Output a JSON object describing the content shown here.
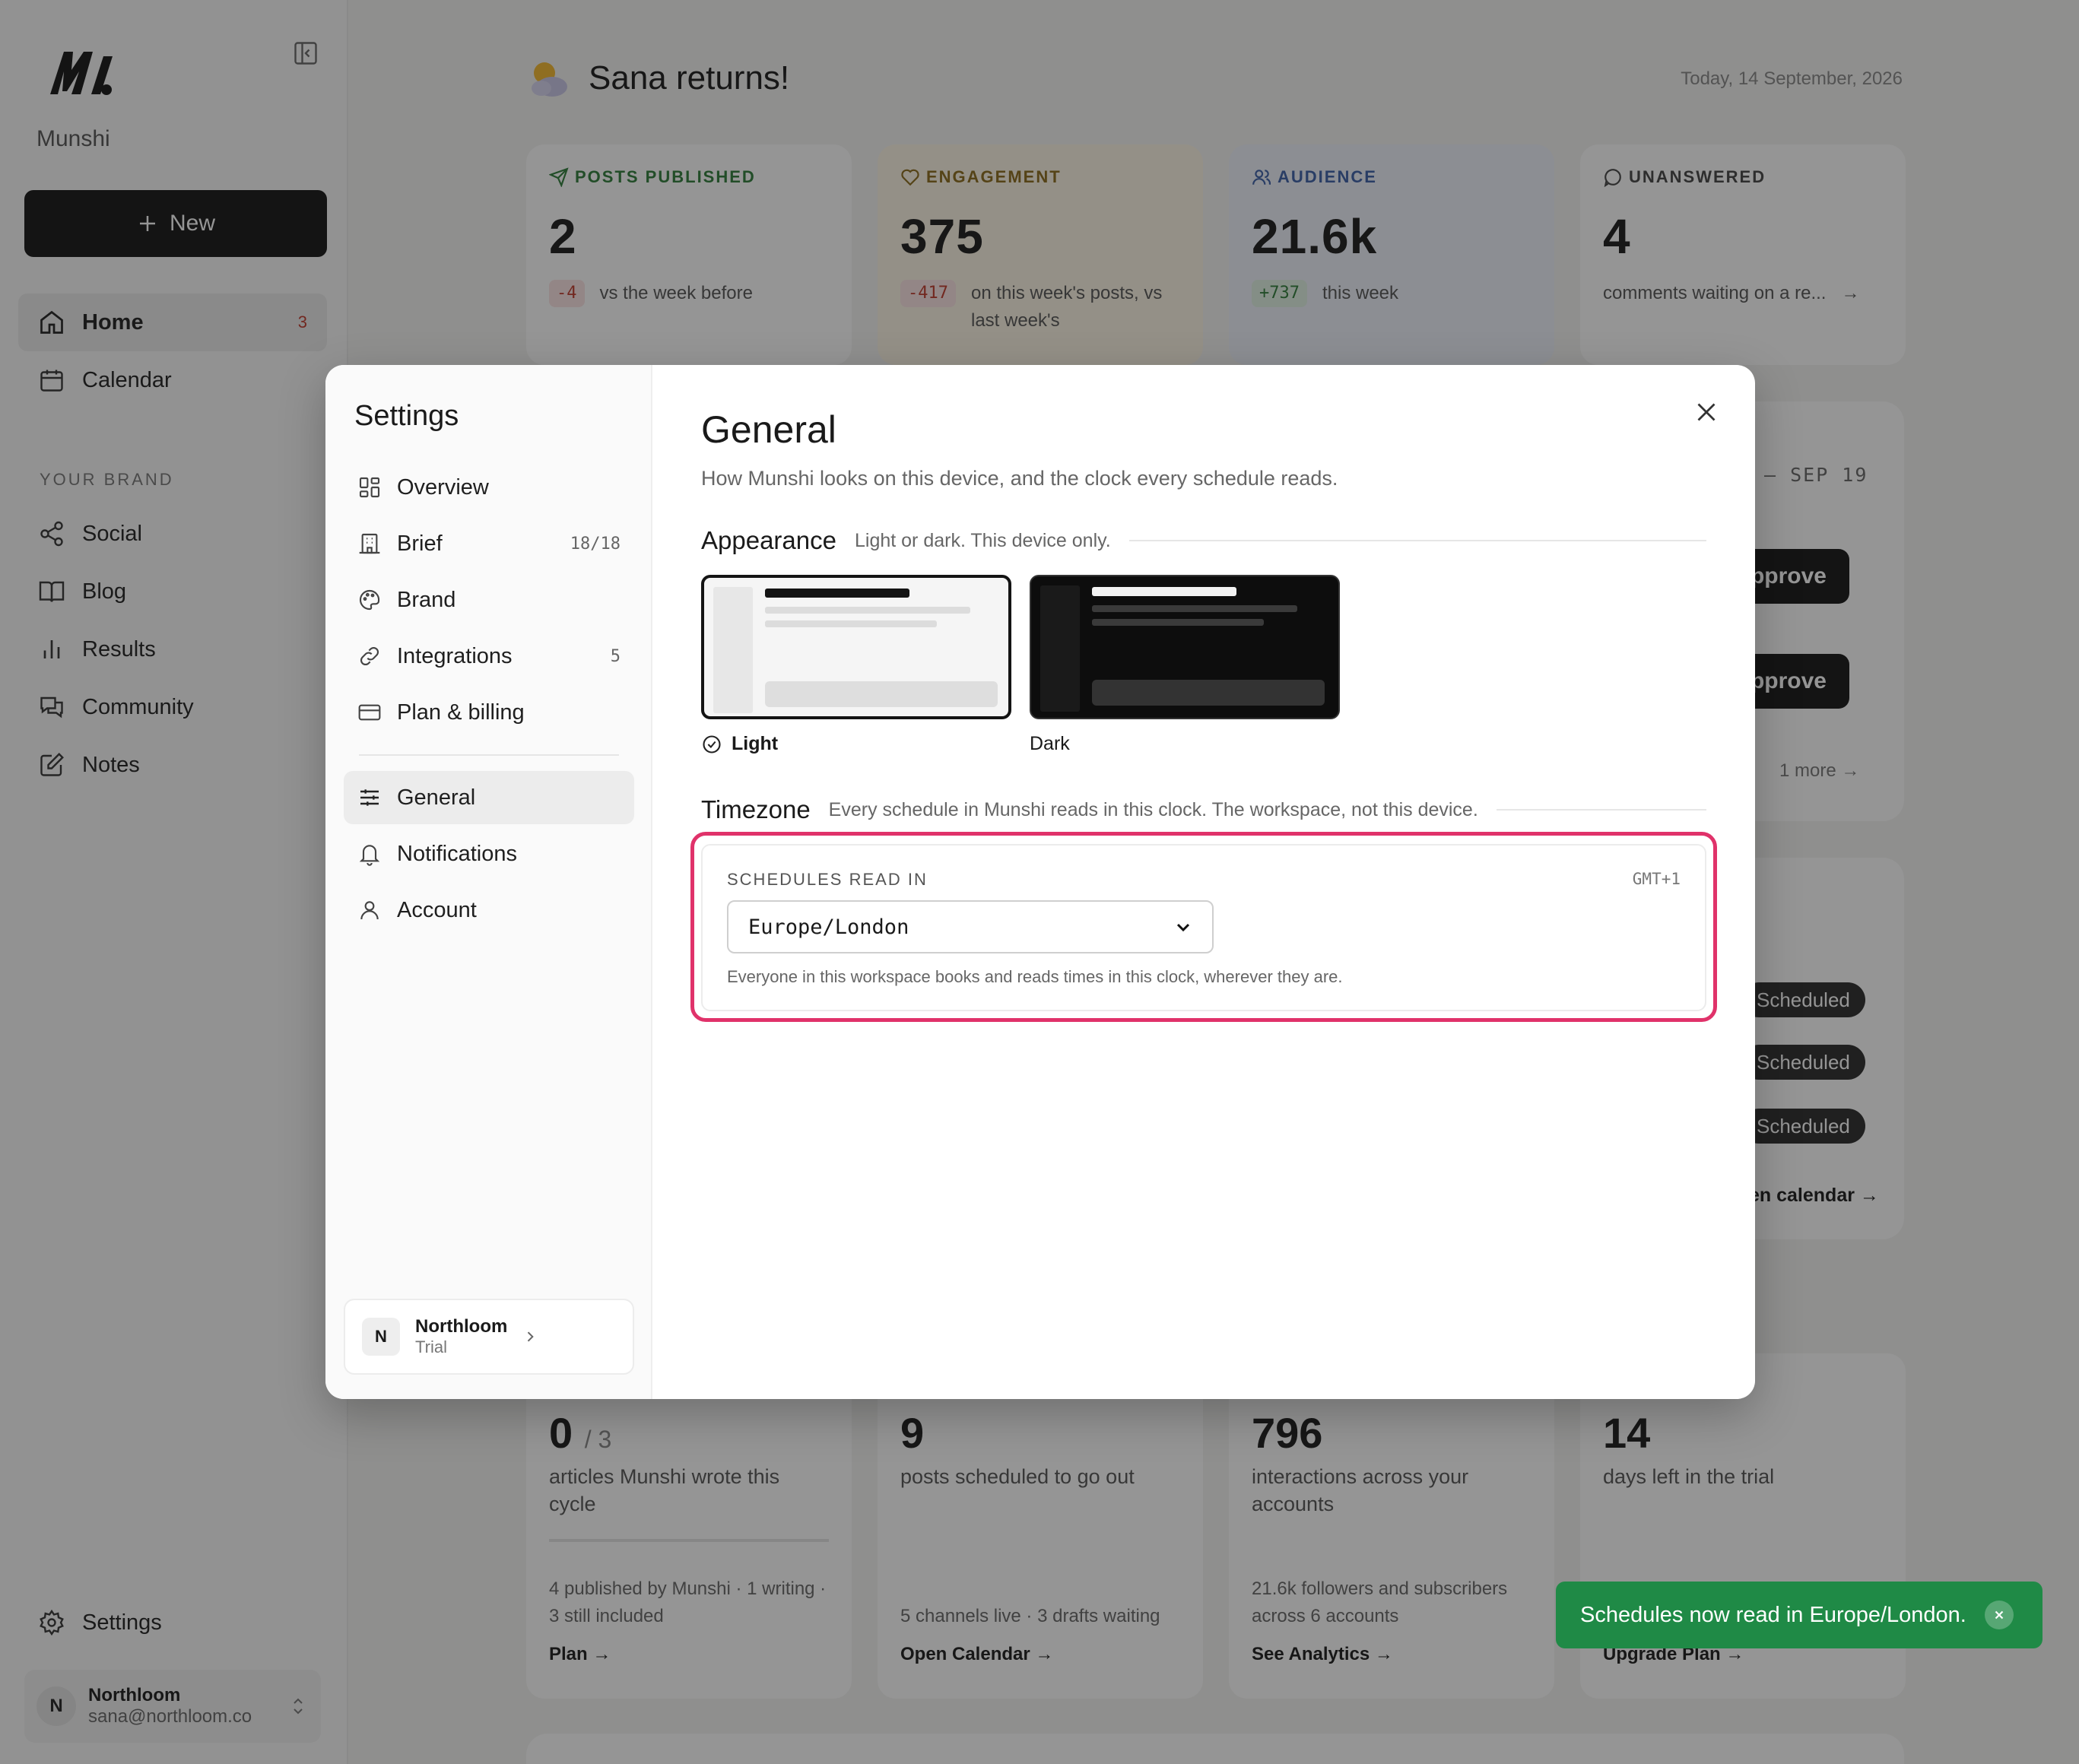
{
  "app": {
    "brand_name": "Munshi",
    "new_button_label": "New",
    "nav": [
      {
        "label": "Home",
        "badge": "3"
      },
      {
        "label": "Calendar"
      }
    ],
    "brand_section_label": "YOUR BRAND",
    "brand_nav": [
      {
        "label": "Social"
      },
      {
        "label": "Blog"
      },
      {
        "label": "Results"
      },
      {
        "label": "Community"
      },
      {
        "label": "Notes"
      }
    ],
    "settings_label": "Settings",
    "user": {
      "initial": "N",
      "name": "Northloom",
      "email": "sana@northloom.co"
    }
  },
  "main": {
    "greeting": "Sana returns!",
    "today": "Today, 14 September, 2026",
    "stats": [
      {
        "label": "POSTS PUBLISHED",
        "value": "2",
        "delta": "-4",
        "note": "vs the week before",
        "color": "#2e7d3a"
      },
      {
        "label": "ENGAGEMENT",
        "value": "375",
        "delta": "-417",
        "note": "on this week's posts, vs last week's",
        "color": "#8a6a1a"
      },
      {
        "label": "AUDIENCE",
        "value": "21.6k",
        "delta": "+737",
        "note": "this week",
        "color": "#3b5fa8"
      },
      {
        "label": "UNANSWERED",
        "value": "4",
        "note": "comments waiting on a re...",
        "color": "#444444"
      }
    ],
    "week_range": "– SEP 19",
    "approve_label": "pprove",
    "more_label": "1 more",
    "scheduled_label": "Scheduled",
    "calendar_link": "en calendar →",
    "bottom_cards": [
      {
        "value": "0",
        "value_suffix": "/ 3",
        "label": "articles Munshi wrote this cycle",
        "foot": "4 published by Munshi · 1 writing · 3 still included",
        "link": "Plan →"
      },
      {
        "value": "9",
        "label": "posts scheduled to go out",
        "foot": "5 channels live · 3 drafts waiting",
        "link": "Open Calendar →"
      },
      {
        "value": "796",
        "label": "interactions across your accounts",
        "foot": "21.6k followers and subscribers across 6 accounts",
        "link": "See Analytics →"
      },
      {
        "value": "14",
        "label": "days left in the trial",
        "foot": "",
        "link": "Upgrade Plan →"
      }
    ]
  },
  "settings": {
    "title": "Settings",
    "nav": [
      {
        "label": "Overview"
      },
      {
        "label": "Brief",
        "count": "18/18"
      },
      {
        "label": "Brand"
      },
      {
        "label": "Integrations",
        "count": "5"
      },
      {
        "label": "Plan & billing"
      },
      {
        "label": "General"
      },
      {
        "label": "Notifications"
      },
      {
        "label": "Account"
      }
    ],
    "workspace": {
      "initial": "N",
      "name": "Northloom",
      "plan": "Trial"
    },
    "general": {
      "heading": "General",
      "description": "How Munshi looks on this device, and the clock every schedule reads.",
      "appearance": {
        "title": "Appearance",
        "subtitle": "Light or dark. This device only.",
        "options": [
          {
            "label": "Light",
            "selected": true
          },
          {
            "label": "Dark",
            "selected": false
          }
        ]
      },
      "timezone": {
        "title": "Timezone",
        "subtitle": "Every schedule in Munshi reads in this clock. The workspace, not this device.",
        "field_label": "SCHEDULES READ IN",
        "offset": "GMT+1",
        "selected": "Europe/London",
        "help": "Everyone in this workspace books and reads times in this clock, wherever they are."
      }
    }
  },
  "toast": {
    "message": "Schedules now read in Europe/London."
  },
  "colors": {
    "accent_focus": "#e0326a",
    "toast_bg": "#1f8a46",
    "primary": "#141414"
  }
}
